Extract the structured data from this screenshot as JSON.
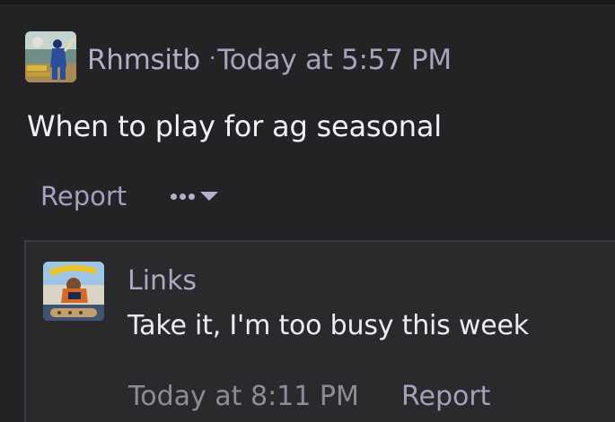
{
  "post": {
    "author": "Rhmsitb",
    "separator": "·",
    "timestamp": "Today at 5:57 PM",
    "body": "When to play for ag seasonal",
    "avatar_icon": "cricket-player-avatar",
    "actions": {
      "report_label": "Report",
      "more_icon": "more-options-icon",
      "dropdown_icon": "chevron-down-icon"
    }
  },
  "reply": {
    "author": "Links",
    "body": "Take it, I'm too busy this week",
    "timestamp": "Today at 8:11 PM",
    "report_label": "Report",
    "avatar_icon": "cartoon-character-avatar"
  },
  "colors": {
    "background": "#232225",
    "reply_background": "#2a292c",
    "accent": "#a79fc0",
    "text": "#f3f1f5",
    "muted": "#8f8b98"
  }
}
